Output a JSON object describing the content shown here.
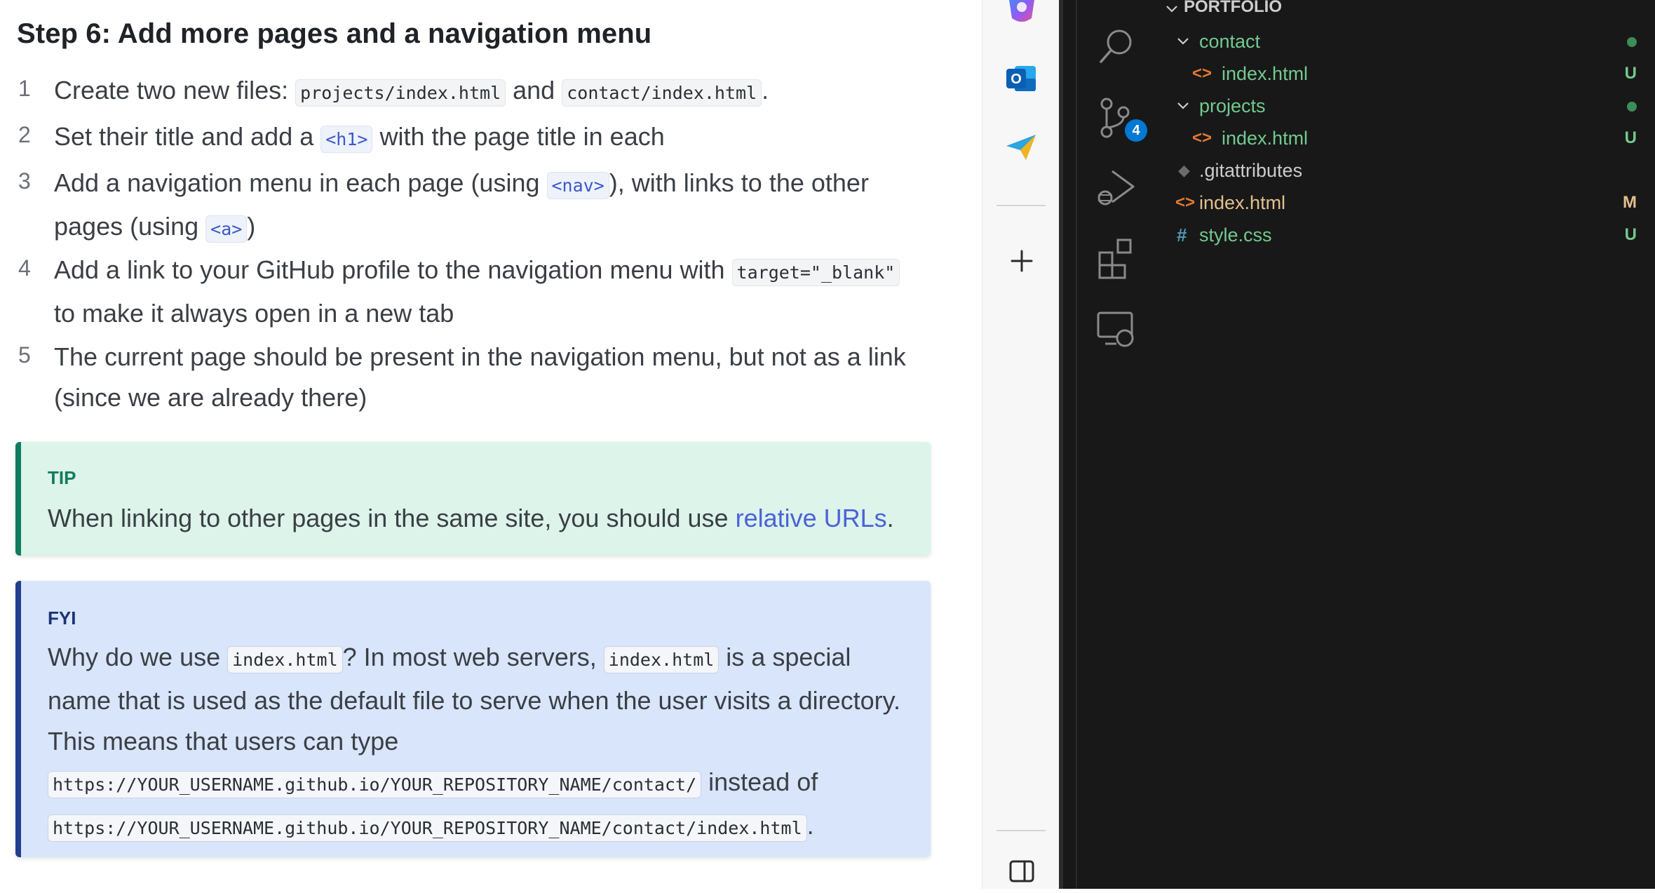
{
  "doc": {
    "heading": "Step 6: Add more pages and a navigation menu",
    "steps": [
      {
        "num": "1",
        "t1": "Create two new files: ",
        "c1": "projects/index.html",
        "t2": " and ",
        "c2": "contact/index.html",
        "t3": "."
      },
      {
        "num": "2",
        "t1": "Set their title and add a ",
        "c1": "<h1>",
        "t2": " with the page title in each"
      },
      {
        "num": "3",
        "t1": "Add a navigation menu in each page (using ",
        "c1": "<nav>",
        "t2": "), with links to the other pages (using ",
        "c2": "<a>",
        "t3": ")"
      },
      {
        "num": "4",
        "t1": "Add a link to your GitHub profile to the navigation menu with ",
        "c1": "target=\"_blank\"",
        "t2": " to make it always open in a new tab"
      },
      {
        "num": "5",
        "t1": "The current page should be present in the navigation menu, but not as a link (since we are already there)"
      }
    ],
    "tip": {
      "label": "TIP",
      "text": "When linking to other pages in the same site, you should use ",
      "link": "relative URLs",
      "end": "."
    },
    "fyi": {
      "label": "FYI",
      "t1": "Why do we use ",
      "c1": "index.html",
      "t2": "? In most web servers, ",
      "c2": "index.html",
      "t3": " is a special name that is used as the default file to serve when the user visits a directory. This means that users can type ",
      "c3": "https://YOUR_USERNAME.github.io/YOUR_REPOSITORY_NAME/contact/",
      "t4": " instead of ",
      "c4": "https://YOUR_USERNAME.github.io/YOUR_REPOSITORY_NAME/contact/index.html",
      "t5": "."
    }
  },
  "sidebar_icons": [
    "copilot-icon",
    "outlook-icon",
    "telegram-icon",
    "add-icon",
    "split-screen-icon"
  ],
  "vscode": {
    "activity_icons": [
      "search-icon",
      "source-control-icon",
      "run-debug-icon",
      "extensions-icon",
      "remote-explorer-icon"
    ],
    "scm_badge": "4",
    "explorer": {
      "root": "PORTFOLIO",
      "items": [
        {
          "name": "contact",
          "kind": "folder",
          "status": ""
        },
        {
          "name": "index.html",
          "kind": "html",
          "status": "U"
        },
        {
          "name": "projects",
          "kind": "folder",
          "status": ""
        },
        {
          "name": "index.html",
          "kind": "html",
          "status": "U"
        },
        {
          "name": ".gitattributes",
          "kind": "git",
          "status": ""
        },
        {
          "name": "index.html",
          "kind": "html",
          "status": "M"
        },
        {
          "name": "style.css",
          "kind": "css",
          "status": "U"
        }
      ]
    }
  },
  "colors": {
    "untracked": "#73c991",
    "modified": "#e2c08d",
    "tip_accent": "#127c5f",
    "fyi_accent": "#233e8c",
    "link": "#4b62d9"
  }
}
